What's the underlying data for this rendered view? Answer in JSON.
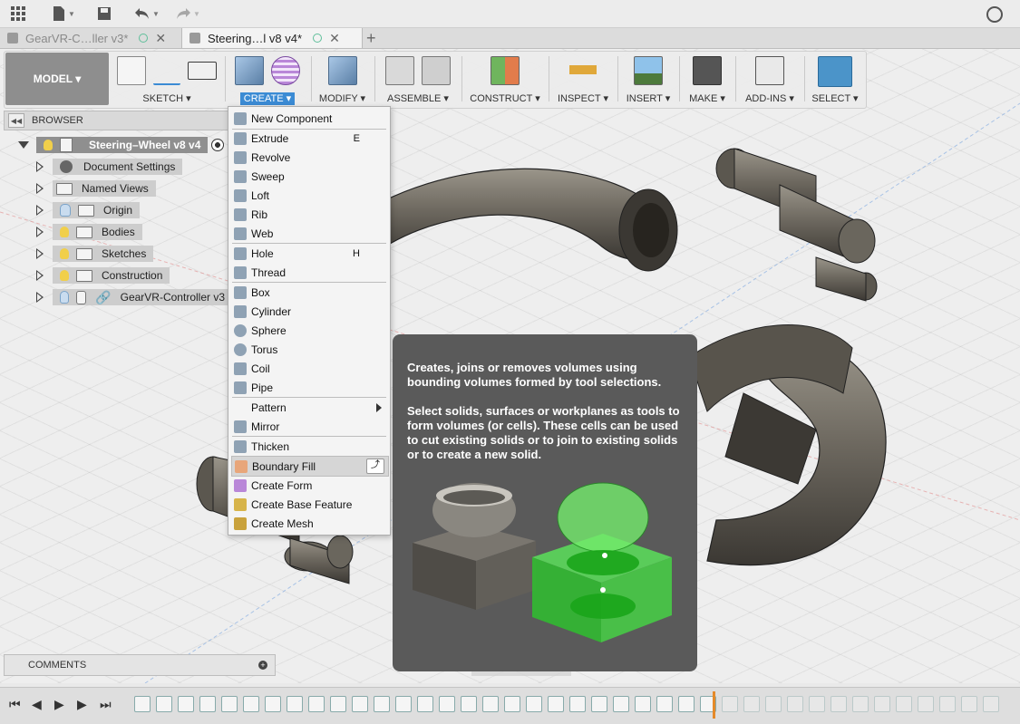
{
  "appbar": {
    "icons": [
      "grid-icon",
      "file-icon",
      "save-icon",
      "undo-icon",
      "redo-icon",
      "clock-icon"
    ]
  },
  "tabs": [
    {
      "label": "GearVR-C…ller v3*",
      "active": false
    },
    {
      "label": "Steering…l v8 v4*",
      "active": true
    }
  ],
  "toolbar": {
    "workspace": "MODEL ▾",
    "groups": {
      "sketch": "SKETCH ▾",
      "create": "CREATE ▾",
      "modify": "MODIFY ▾",
      "assemble": "ASSEMBLE ▾",
      "construct": "CONSTRUCT ▾",
      "inspect": "INSPECT ▾",
      "insert": "INSERT ▾",
      "make": "MAKE ▾",
      "addins": "ADD-INS ▾",
      "select": "SELECT ▾"
    }
  },
  "browser": {
    "title": "BROWSER",
    "root": "Steering–Wheel v8 v4",
    "items": [
      {
        "label": "Document Settings"
      },
      {
        "label": "Named Views"
      },
      {
        "label": "Origin"
      },
      {
        "label": "Bodies"
      },
      {
        "label": "Sketches"
      },
      {
        "label": "Construction"
      },
      {
        "label": "GearVR-Controller v3"
      }
    ]
  },
  "comments": {
    "title": "COMMENTS"
  },
  "create_menu": {
    "items": [
      {
        "label": "New Component",
        "shortcut": ""
      },
      {
        "label": "Extrude",
        "shortcut": "E"
      },
      {
        "label": "Revolve",
        "shortcut": ""
      },
      {
        "label": "Sweep",
        "shortcut": ""
      },
      {
        "label": "Loft",
        "shortcut": ""
      },
      {
        "label": "Rib",
        "shortcut": ""
      },
      {
        "label": "Web",
        "shortcut": ""
      },
      {
        "label": "Hole",
        "shortcut": "H"
      },
      {
        "label": "Thread",
        "shortcut": ""
      },
      {
        "label": "Box",
        "shortcut": ""
      },
      {
        "label": "Cylinder",
        "shortcut": ""
      },
      {
        "label": "Sphere",
        "shortcut": ""
      },
      {
        "label": "Torus",
        "shortcut": ""
      },
      {
        "label": "Coil",
        "shortcut": ""
      },
      {
        "label": "Pipe",
        "shortcut": ""
      },
      {
        "label": "Pattern",
        "shortcut": ""
      },
      {
        "label": "Mirror",
        "shortcut": ""
      },
      {
        "label": "Thicken",
        "shortcut": ""
      },
      {
        "label": "Boundary Fill",
        "shortcut": ""
      },
      {
        "label": "Create Form",
        "shortcut": ""
      },
      {
        "label": "Create Base Feature",
        "shortcut": ""
      },
      {
        "label": "Create Mesh",
        "shortcut": ""
      }
    ]
  },
  "tooltip": {
    "heading": "Creates, joins or removes volumes using bounding volumes formed by tool selections.",
    "body": "Select solids, surfaces or workplanes as tools to form volumes (or cells). These cells can be used to cut existing solids or to join to existing solids or to create a new solid."
  },
  "colors": {
    "accent": "#3b8bd4",
    "menu_bg": "#f4f4f4",
    "tooltip_bg": "#5a5a5a",
    "part_metal": "#6e6960",
    "fill_green": "#39d13a"
  }
}
